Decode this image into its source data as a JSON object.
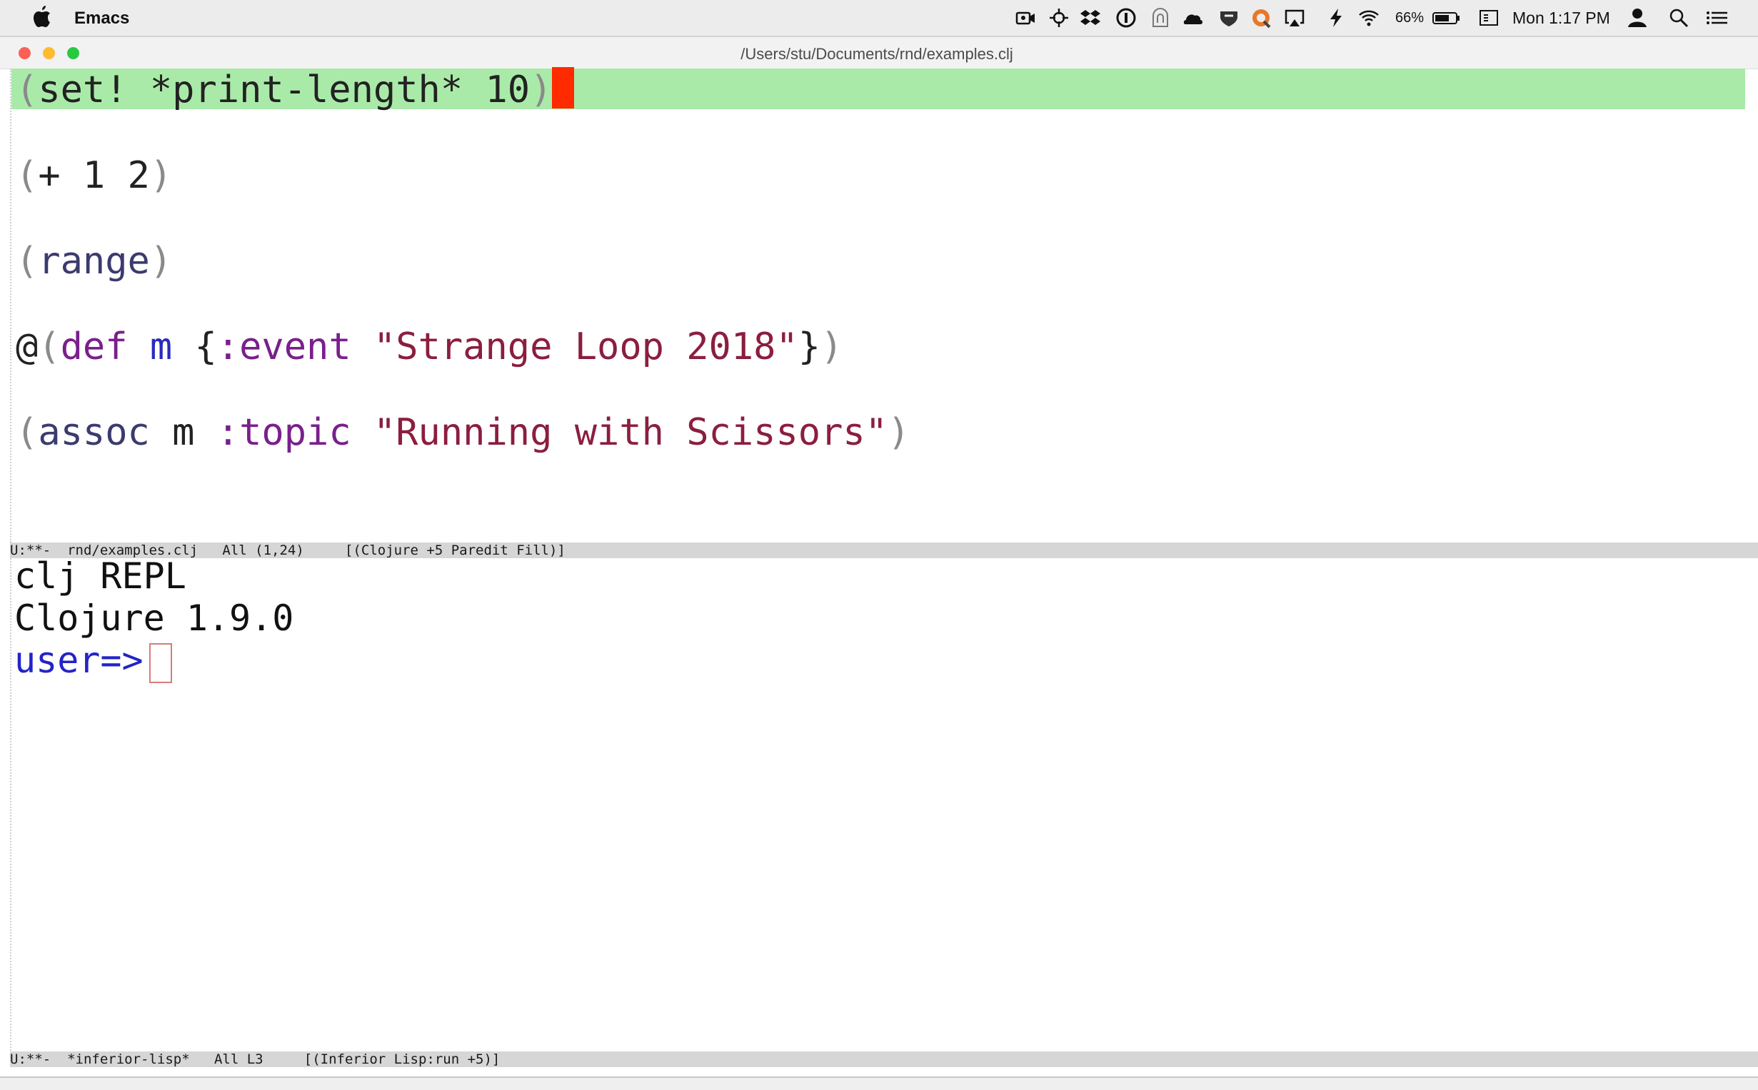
{
  "menubar": {
    "app_name": "Emacs",
    "battery": "66%",
    "clock": "Mon 1:17 PM",
    "icons": [
      "apple-icon",
      "facetime-icon",
      "crosshair-icon",
      "dropbox-icon",
      "onepassword-icon",
      "lock-app-icon",
      "cloud-icon",
      "shield-icon",
      "rss-icon",
      "airplay-icon",
      "bolt-icon",
      "wifi-icon",
      "battery-icon",
      "display-icon",
      "user-icon",
      "search-icon",
      "list-icon"
    ]
  },
  "window": {
    "title": "/Users/stu/Documents/rnd/examples.clj",
    "lights": {
      "close": "#fc5f57",
      "minimize": "#fdbb2f",
      "zoom": "#28c940"
    }
  },
  "editor": {
    "line1": {
      "open": "(",
      "body": "set! *print-length* 10",
      "close": ")"
    },
    "line2": {
      "open": "(",
      "body": "+ 1 2",
      "close": ")"
    },
    "line3": {
      "open": "(",
      "body": "range",
      "close": ")"
    },
    "line4": {
      "at": "@",
      "open": "(",
      "def": "def",
      "name": "m",
      "brace_open": " {",
      "key": ":event",
      "str": "\"Strange Loop 2018\"",
      "brace_close": "}",
      "close": ")"
    },
    "line5": {
      "open": "(",
      "fn": "assoc",
      "sym": " m ",
      "key": ":topic",
      "str": "\"Running with Scissors\"",
      "close": ")"
    },
    "modeline": "U:**-  rnd/examples.clj   All (1,24)     [(Clojure +5 Paredit Fill)]"
  },
  "repl": {
    "line1": "clj REPL",
    "line2": "Clojure 1.9.0",
    "prompt": "user=>",
    "modeline": "U:**-  *inferior-lisp*   All L3     [(Inferior Lisp:run +5)]"
  }
}
